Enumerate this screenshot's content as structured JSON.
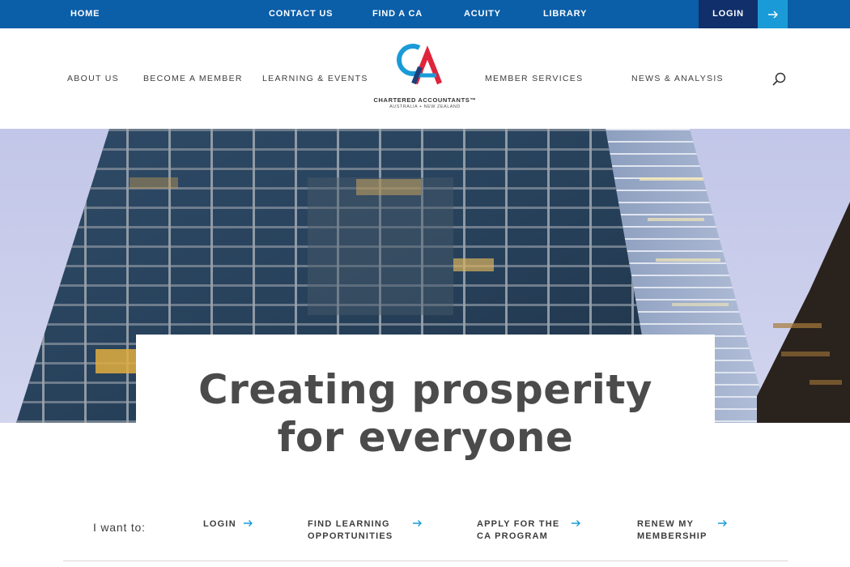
{
  "topbar": {
    "home": "HOME",
    "contact_us": "CONTACT US",
    "find_a_ca": "FIND A CA",
    "acuity": "ACUITY",
    "library": "LIBRARY",
    "login": "LOGIN"
  },
  "mainnav": {
    "items": [
      "ABOUT US",
      "BECOME A MEMBER",
      "LEARNING & EVENTS",
      "MEMBER SERVICES",
      "NEWS & ANALYSIS"
    ]
  },
  "logo": {
    "name": "CHARTERED ACCOUNTANTS™",
    "subtitle": "AUSTRALIA + NEW ZEALAND"
  },
  "hero": {
    "title_line1": "Creating prosperity",
    "title_line2": "for everyone"
  },
  "actions": {
    "prompt": "I want to:",
    "items": [
      "LOGIN",
      "FIND LEARNING\nOPPORTUNITIES",
      "APPLY FOR THE\nCA PROGRAM",
      "RENEW MY\nMEMBERSHIP"
    ]
  },
  "colors": {
    "topbar": "#0b5ea8",
    "login_bg": "#102f6b",
    "login_arrow_bg": "#1a9bd7",
    "accent_arrow": "#1a9bd7",
    "logo_blue": "#1a9bd7",
    "logo_red": "#e0243a"
  },
  "icons": {
    "search": "search-icon",
    "arrow": "arrow-right-icon"
  }
}
